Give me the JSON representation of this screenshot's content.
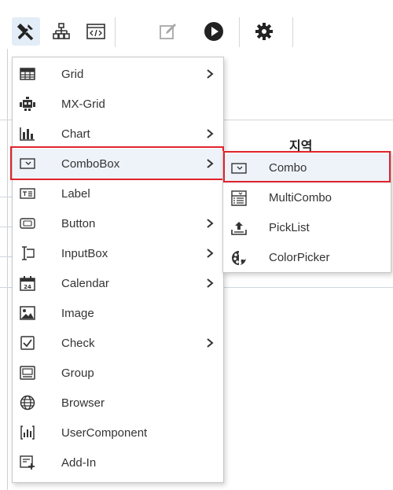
{
  "background": {
    "column_header": "지역"
  },
  "toolbar": {
    "buttons": [
      {
        "icon": "tools-icon"
      },
      {
        "icon": "hierarchy-icon"
      },
      {
        "icon": "code-window-icon"
      },
      {
        "icon": "edit-icon"
      },
      {
        "icon": "play-icon"
      },
      {
        "icon": "gear-icon"
      }
    ]
  },
  "menu": {
    "items": [
      {
        "label": "Grid",
        "icon": "grid-icon",
        "has_submenu": true
      },
      {
        "label": "MX-Grid",
        "icon": "robot-icon",
        "has_submenu": false
      },
      {
        "label": "Chart",
        "icon": "bar-chart-icon",
        "has_submenu": true
      },
      {
        "label": "ComboBox",
        "icon": "combobox-icon",
        "has_submenu": true
      },
      {
        "label": "Label",
        "icon": "label-icon",
        "has_submenu": false
      },
      {
        "label": "Button",
        "icon": "button-icon",
        "has_submenu": true
      },
      {
        "label": "InputBox",
        "icon": "inputbox-icon",
        "has_submenu": true
      },
      {
        "label": "Calendar",
        "icon": "calendar-icon",
        "has_submenu": true
      },
      {
        "label": "Image",
        "icon": "image-icon",
        "has_submenu": false
      },
      {
        "label": "Check",
        "icon": "checkbox-icon",
        "has_submenu": true
      },
      {
        "label": "Group",
        "icon": "group-icon",
        "has_submenu": false
      },
      {
        "label": "Browser",
        "icon": "globe-icon",
        "has_submenu": false
      },
      {
        "label": "UserComponent",
        "icon": "user-component-icon",
        "has_submenu": false
      },
      {
        "label": "Add-In",
        "icon": "add-in-icon",
        "has_submenu": false
      }
    ]
  },
  "submenu": {
    "items": [
      {
        "label": "Combo",
        "icon": "combobox-icon"
      },
      {
        "label": "MultiCombo",
        "icon": "multicombo-icon"
      },
      {
        "label": "PickList",
        "icon": "picklist-icon"
      },
      {
        "label": "ColorPicker",
        "icon": "color-palette-icon"
      }
    ]
  },
  "colors": {
    "highlight_border": "#e0232b",
    "menu_border": "#c8c8c8",
    "active_toolbar_bg": "#e3edf7",
    "icon_dark": "#333333"
  }
}
